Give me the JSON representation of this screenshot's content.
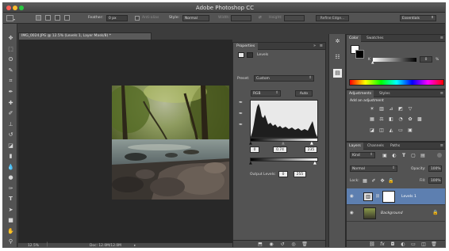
{
  "app": {
    "title": "Adobe Photoshop CC"
  },
  "options_bar": {
    "feather_label": "Feather:",
    "feather_value": "0 px",
    "antialias_label": "Anti-alias",
    "style_label": "Style:",
    "style_value": "Normal",
    "width_label": "Width:",
    "height_label": "Height:",
    "refine_edge_label": "Refine Edge...",
    "workspace_value": "Essentials"
  },
  "document": {
    "tab_title": "IMG_0024.JPG @ 12.5% (Levels 1, Layer Mask/8) *",
    "zoom": "12.5%",
    "doc_size": "Doc: 12.0M/12.0M"
  },
  "properties_panel": {
    "tab_label": "Properties",
    "adjustment_title": "Levels",
    "preset_label": "Preset:",
    "preset_value": "Custom",
    "channel_value": "RGB",
    "auto_label": "Auto",
    "input_shadow": "0",
    "input_midtone": "0.74",
    "input_highlight": "235",
    "output_label": "Output Levels:",
    "output_low": "0",
    "output_high": "255"
  },
  "color_panel": {
    "tabs": [
      "Color",
      "Swatches"
    ],
    "k_label": "K",
    "k_value": "0",
    "k_unit": "%"
  },
  "adjustments_panel": {
    "tabs": [
      "Adjustments",
      "Styles"
    ],
    "title": "Add an adjustment"
  },
  "layers_panel": {
    "tabs": [
      "Layers",
      "Channels",
      "Paths"
    ],
    "kind_value": "Kind",
    "blend_mode": "Normal",
    "opacity_label": "Opacity:",
    "opacity_value": "100%",
    "lock_label": "Lock:",
    "fill_label": "Fill:",
    "fill_value": "100%",
    "layers": [
      {
        "name": "Levels 1",
        "selected": true
      },
      {
        "name": "Background",
        "selected": false
      }
    ]
  },
  "colors": {
    "ui_dark": "#3c3c3c",
    "panel": "#535353",
    "selected_layer": "#5d7fb0"
  }
}
